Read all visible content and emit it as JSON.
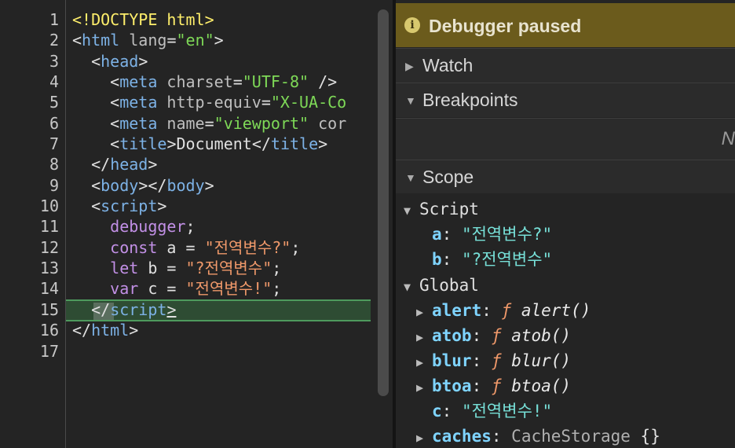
{
  "editor": {
    "line_numbers": [
      "1",
      "2",
      "3",
      "4",
      "5",
      "6",
      "7",
      "8",
      "9",
      "10",
      "11",
      "12",
      "13",
      "14",
      "15",
      "16",
      "17"
    ],
    "lines": {
      "l1_doctype": "<!DOCTYPE html>",
      "l2_lt": "<",
      "l2_tag": "html",
      "l2_attr": " lang",
      "l2_eq": "=",
      "l2_val": "\"en\"",
      "l2_gt": ">",
      "l3_lt": "<",
      "l3_tag": "head",
      "l3_gt": ">",
      "l4_lt": "<",
      "l4_tag": "meta",
      "l4_attr": " charset",
      "l4_eq": "=",
      "l4_val": "\"UTF-8\"",
      "l4_end": " />",
      "l5_lt": "<",
      "l5_tag": "meta",
      "l5_attr": " http-equiv",
      "l5_eq": "=",
      "l5_val": "\"X-UA-Co",
      "l6_lt": "<",
      "l6_tag": "meta",
      "l6_attr": " name",
      "l6_eq": "=",
      "l6_val": "\"viewport\"",
      "l6_rest": " cor",
      "l7_lt": "<",
      "l7_tag": "title",
      "l7_gt": ">",
      "l7_text": "Document",
      "l7_close_lt": "</",
      "l7_close_tag": "title",
      "l7_close_gt": ">",
      "l8_lt": "</",
      "l8_tag": "head",
      "l8_gt": ">",
      "l9_lt": "<",
      "l9_tag": "body",
      "l9_mid": "></",
      "l9_tag2": "body",
      "l9_gt": ">",
      "l10_lt": "<",
      "l10_tag": "script",
      "l10_gt": ">",
      "l11_kw": "debugger",
      "l11_end": ";",
      "l12_kw": "const",
      "l12_mid": " a = ",
      "l12_str": "\"전역변수?\"",
      "l12_end": ";",
      "l13_kw": "let",
      "l13_mid": " b = ",
      "l13_str": "\"?전역변수\"",
      "l13_end": ";",
      "l14_kw": "var",
      "l14_mid": " c = ",
      "l14_str": "\"전역변수!\"",
      "l14_end": ";",
      "l15_lt": "</",
      "l15_tag": "script",
      "l15_gt": ">",
      "l16_lt": "</",
      "l16_tag": "html",
      "l16_gt": ">"
    }
  },
  "debugger": {
    "banner": "Debugger paused",
    "info_icon_glyph": "i",
    "sections": {
      "watch": "Watch",
      "breakpoints": "Breakpoints",
      "scope": "Scope"
    },
    "breakpoints_truncated": "N"
  },
  "scope": {
    "script_label": "Script",
    "script_vars": [
      {
        "key": "a",
        "value": "\"전역변수?\""
      },
      {
        "key": "b",
        "value": "\"?전역변수\""
      }
    ],
    "global_label": "Global",
    "global_vars": [
      {
        "key": "alert",
        "f": "ƒ",
        "value": "alert()"
      },
      {
        "key": "atob",
        "f": "ƒ",
        "value": "atob()"
      },
      {
        "key": "blur",
        "f": "ƒ",
        "value": "blur()"
      },
      {
        "key": "btoa",
        "f": "ƒ",
        "value": "btoa()"
      },
      {
        "key": "c",
        "value": "\"전역변수!\""
      },
      {
        "key": "caches",
        "value": "CacheStorage",
        "suffix": "{}"
      }
    ],
    "colon": ":"
  }
}
